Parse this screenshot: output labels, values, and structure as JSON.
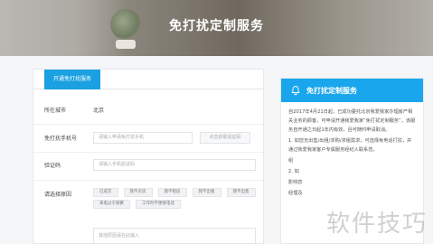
{
  "banner": {
    "title": "免打扰定制服务"
  },
  "form": {
    "tab_label": "开通免打扰服务",
    "city": {
      "label": "所在城市",
      "value": "北京"
    },
    "phone": {
      "label": "免打扰手机号",
      "placeholder": "请输入申请免打扰手机",
      "code_button": "点击获取验证码"
    },
    "verify": {
      "label": "验证码",
      "placeholder": "请输入手机验证码"
    },
    "reason": {
      "label": "请选择原因",
      "chips": [
        "已成交",
        "我不买房",
        "我不租房",
        "我不出租",
        "我不出售",
        "来电过于频繁",
        "工作时不便接电话"
      ],
      "other_placeholder": "其他原因请在此输入"
    }
  },
  "notice": {
    "title": "免打扰定制服务",
    "paragraphs": [
      "自2017年4月21日起，已成功委托北京我爱我家办理房产相关业务的顾客，可申请开通我爱我家“免打扰定制服务”，该服务自开通之日起1年内有效，且可随时申请取消。",
      "1. 如您无出售/出租/求购/求租需求，可选择免电话打扰，并通过我爱我家客户专属服务经纪人联系您。",
      "组",
      "2. 如",
      "影响您",
      "经理及"
    ]
  },
  "watermark": "软件技巧"
}
